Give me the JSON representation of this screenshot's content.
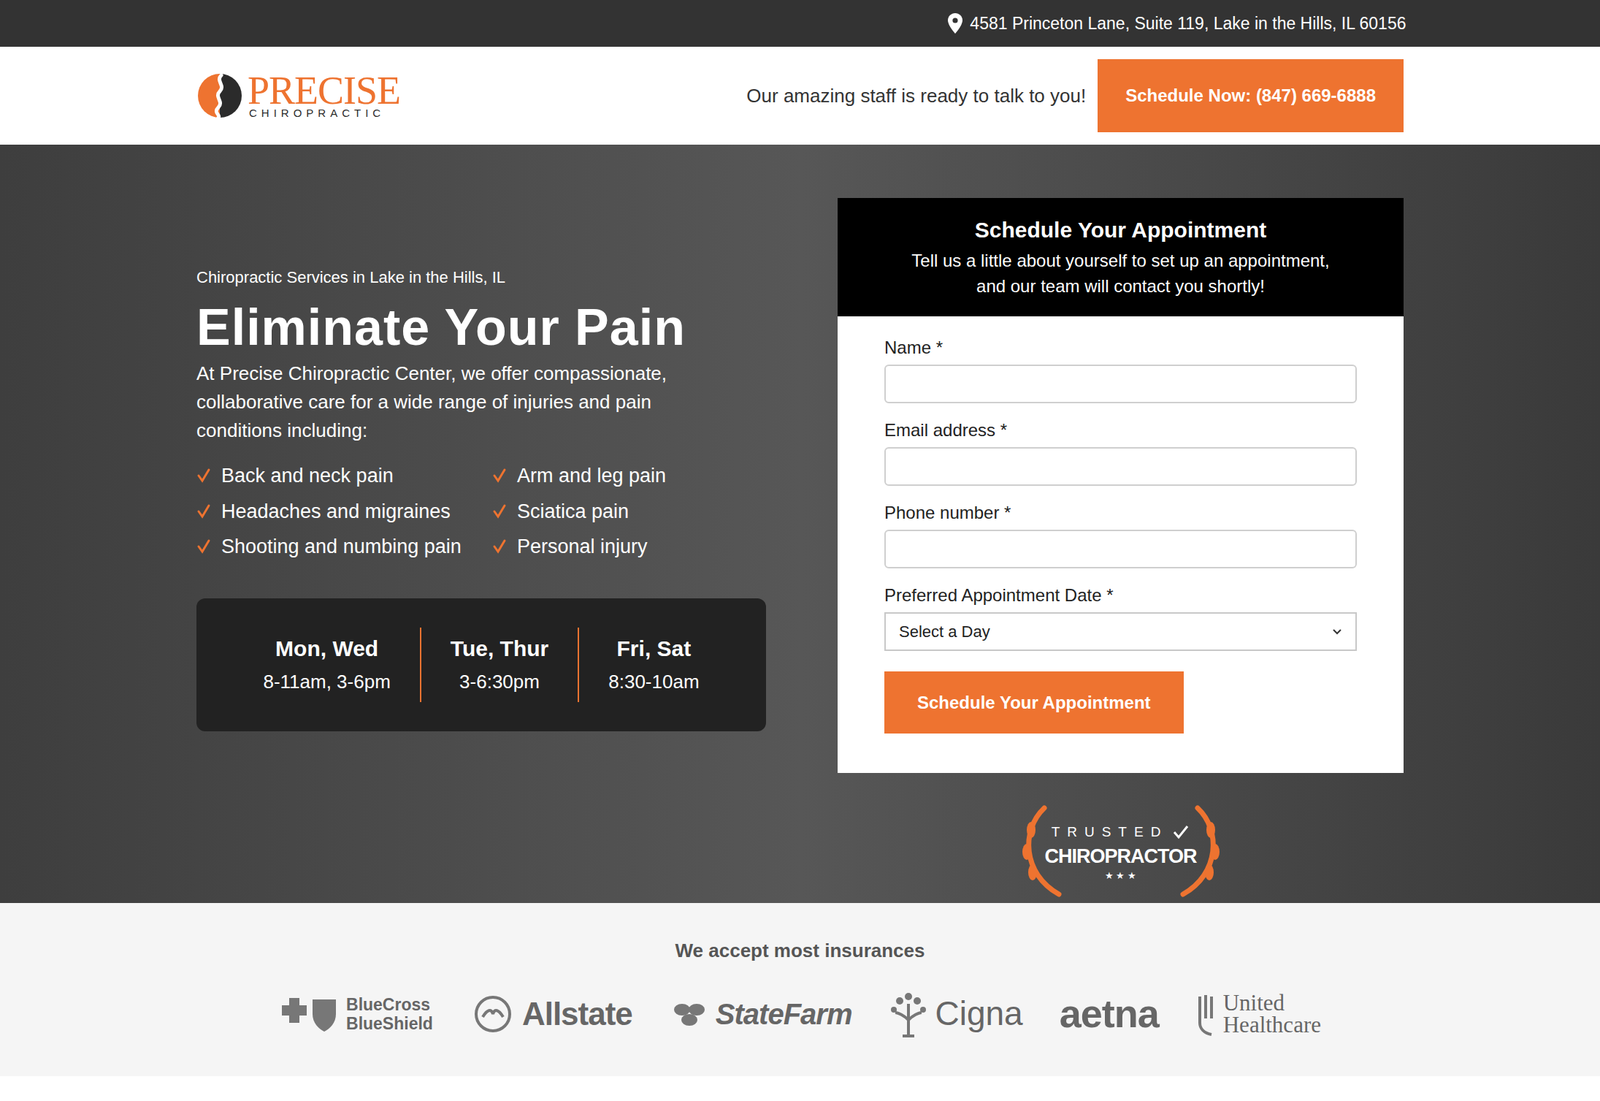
{
  "top_bar": {
    "address": "4581 Princeton Lane, Suite 119, Lake in the Hills, IL 60156"
  },
  "header": {
    "logo_name": "PRECISE",
    "logo_sub": "CHIROPRACTIC",
    "message": "Our amazing staff is ready to talk to you!",
    "cta": "Schedule Now: (847) 669-6888"
  },
  "hero": {
    "eyebrow": "Chiropractic Services in Lake in the Hills, IL",
    "title": "Eliminate Your Pain",
    "intro": "At Precise Chiropractic Center, we offer compassionate, collaborative care for a wide range of injuries and pain conditions including:",
    "conditions": [
      "Back and neck pain",
      "Arm and leg pain",
      "Headaches and migraines",
      "Sciatica pain",
      "Shooting and numbing pain",
      "Personal injury"
    ],
    "hours": [
      {
        "days": "Mon, Wed",
        "times": "8-11am, 3-6pm"
      },
      {
        "days": "Tue, Thur",
        "times": "3-6:30pm"
      },
      {
        "days": "Fri, Sat",
        "times": "8:30-10am"
      }
    ]
  },
  "form": {
    "title": "Schedule Your Appointment",
    "subtitle": [
      "Tell us a little about yourself to set up an appointment,",
      "and our team will contact you shortly!"
    ],
    "fields": [
      {
        "label": "Name *",
        "kind": "text",
        "value": ""
      },
      {
        "label": "Email address *",
        "kind": "text",
        "value": ""
      },
      {
        "label": "Phone number *",
        "kind": "text",
        "value": ""
      },
      {
        "label": "Preferred Appointment Date *",
        "kind": "select",
        "value": "Select a Day"
      }
    ],
    "submit": "Schedule Your Appointment"
  },
  "badge": {
    "top": "TRUSTED",
    "main": "CHIROPRACTOR",
    "stars": "★ ★ ★"
  },
  "insurance": {
    "title": "We accept most insurances",
    "logos": [
      {
        "kind": "bcbs",
        "lines": [
          "BlueCross",
          "BlueShield"
        ]
      },
      {
        "kind": "allstate",
        "lines": [
          "Allstate"
        ]
      },
      {
        "kind": "statefarm",
        "lines": [
          "StateFarm"
        ]
      },
      {
        "kind": "cigna",
        "lines": [
          "Cigna"
        ]
      },
      {
        "kind": "aetna",
        "lines": [
          "aetna"
        ]
      },
      {
        "kind": "uhc",
        "lines": [
          "United",
          "Healthcare"
        ]
      }
    ]
  }
}
